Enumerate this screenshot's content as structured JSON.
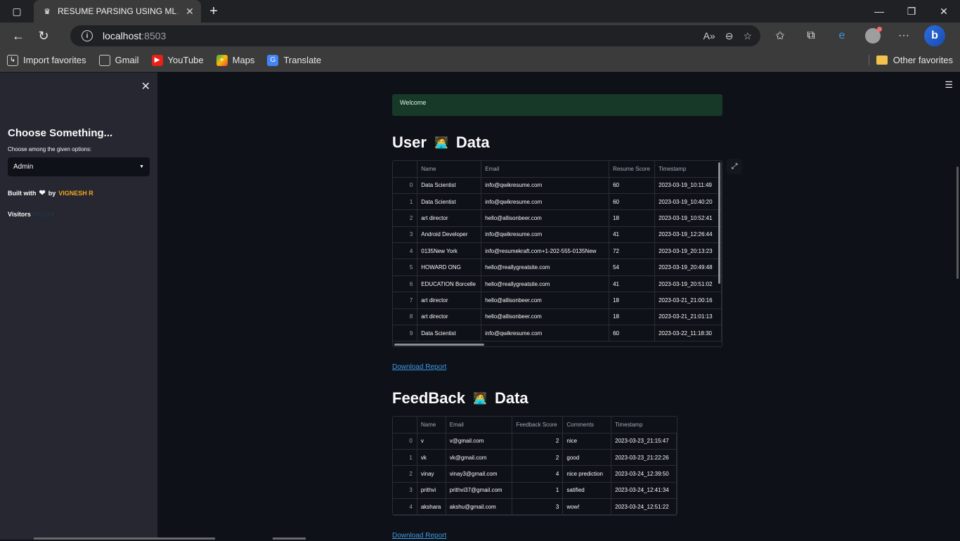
{
  "browser": {
    "tab_title": "RESUME PARSING USING ML AN",
    "url_host": "localhost",
    "url_port": ":8503",
    "favorites": [
      {
        "label": "Import favorites",
        "icon": "import-icon",
        "color": "#4a4a4a"
      },
      {
        "label": "Gmail",
        "icon": "page-icon",
        "color": "#4a4a4a"
      },
      {
        "label": "YouTube",
        "icon": "youtube-icon",
        "color": "#e62117"
      },
      {
        "label": "Maps",
        "icon": "maps-icon",
        "color": "#34a853"
      },
      {
        "label": "Translate",
        "icon": "translate-icon",
        "color": "#4285f4"
      }
    ],
    "other_favorites": "Other favorites"
  },
  "sidebar": {
    "heading": "Choose Something...",
    "select_label": "Choose among the given options:",
    "select_value": "Admin",
    "built_prefix": "Built with",
    "built_by": "by",
    "author": "VIGNESH R",
    "visitors_label": "Visitors",
    "visitors_count": "001128"
  },
  "main": {
    "alert": "Welcome",
    "user_heading_left": "User",
    "user_heading_right": "Data",
    "feedback_heading_left": "FeedBack",
    "feedback_heading_right": "Data",
    "download_label_1": "Download Report",
    "download_label_2": "Download Report"
  },
  "user_table": {
    "columns": [
      "Name",
      "Email",
      "Resume Score",
      "Timestamp"
    ],
    "rows": [
      [
        "0",
        "Data Scientist",
        "info@qwikresume.com",
        "60",
        "2023-03-19_10:11:49"
      ],
      [
        "1",
        "Data Scientist",
        "info@qwikresume.com",
        "60",
        "2023-03-19_10:40:20"
      ],
      [
        "2",
        "art director",
        "hello@allisonbeer.com",
        "18",
        "2023-03-19_10:52:41"
      ],
      [
        "3",
        "Android Developer",
        "info@qwikresume.com",
        "41",
        "2023-03-19_12:26:44"
      ],
      [
        "4",
        "0135New York",
        "info@resumekraft.com+1-202-555-0135New",
        "72",
        "2023-03-19_20:13:23"
      ],
      [
        "5",
        "HOWARD ONG",
        "hello@reallygreatsite.com",
        "54",
        "2023-03-19_20:49:48"
      ],
      [
        "6",
        "EDUCATION Borcelle",
        "hello@reallygreatsite.com",
        "41",
        "2023-03-19_20:51:02"
      ],
      [
        "7",
        "art director",
        "hello@allisonbeer.com",
        "18",
        "2023-03-21_21:00:16"
      ],
      [
        "8",
        "art director",
        "hello@allisonbeer.com",
        "18",
        "2023-03-21_21:01:13"
      ],
      [
        "9",
        "Data Scientist",
        "info@qwikresume.com",
        "60",
        "2023-03-22_11:18:30"
      ]
    ]
  },
  "feedback_table": {
    "columns": [
      "Name",
      "Email",
      "Feedback Score",
      "Comments",
      "Timestamp"
    ],
    "rows": [
      [
        "0",
        "v",
        "v@gmail.com",
        "2",
        "nice",
        "2023-03-23_21:15:47"
      ],
      [
        "1",
        "vk",
        "vk@gmail.com",
        "2",
        "good",
        "2023-03-23_21:22:26"
      ],
      [
        "2",
        "vinay",
        "vinay3@gmail.com",
        "4",
        "nice prediction",
        "2023-03-24_12:39:50"
      ],
      [
        "3",
        "prithvi",
        "prithvi37@gmail.com",
        "1",
        "satified",
        "2023-03-24_12:41:34"
      ],
      [
        "4",
        "akshara",
        "akshu@gmail.com",
        "3",
        "wow!",
        "2023-03-24_12:51:22"
      ]
    ]
  }
}
